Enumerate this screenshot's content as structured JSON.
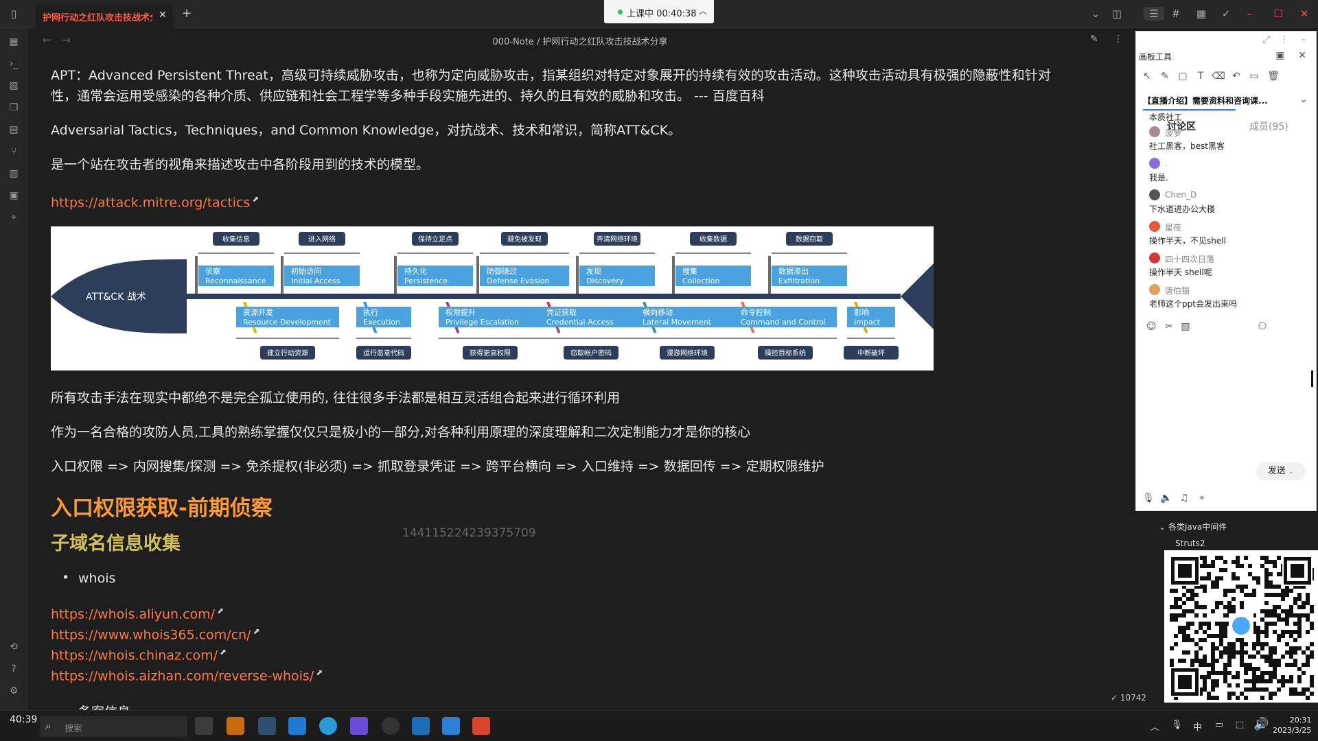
{
  "tab": {
    "title": "护网行动之红队攻击技战术分享",
    "close": "✕",
    "add": "+"
  },
  "live": {
    "status": "上课中 00:40:38"
  },
  "breadcrumb": "000-Note / 护网行动之红队攻击技战术分享",
  "doc": {
    "apt_line1": "APT：Advanced Persistent Threat，高级可持续威胁攻击，也称为定向威胁攻击，指某组织对特定对象展开的持续有效的攻击活动。这种攻击活动具有极强的隐蔽性和针对",
    "apt_line2": "性，通常会运用受感染的各种介质、供应链和社会工程学等多种手段实施先进的、持久的且有效的威胁和攻击。  --- 百度百科",
    "attck_def": "Adversarial Tactics，Techniques，and Common Knowledge，对抗战术、技术和常识，简称ATT&CK。",
    "model_desc": "是一个站在攻击者的视角来描述攻击中各阶段用到的技术的模型。",
    "mitre_link": "https://attack.mitre.org/tactics",
    "para1": "所有攻击手法在现实中都绝不是完全孤立使用的, 往往很多手法都是相互灵活组合起来进行循环利用",
    "para2": "作为一名合格的攻防人员,工具的熟练掌握仅仅只是极小的一部分,对各种利用原理的深度理解和二次定制能力才是你的核心",
    "chain": "入口权限 => 内网搜集/探测 => 免杀提权(非必须) => 抓取登录凭证 => 跨平台横向 => 入口维持 => 数据回传 => 定期权限维护",
    "h1": "入口权限获取-前期侦察",
    "h2": "子域名信息收集",
    "bullet_whois": "whois",
    "whois_links": [
      "https://whois.aliyun.com/",
      "https://www.whois365.com/cn/",
      "https://whois.chinaz.com/",
      "https://whois.aizhan.com/reverse-whois/"
    ],
    "bullet_partial": "备案信息",
    "watermark": "144115224239375709"
  },
  "diagram": {
    "head_label": "ATT&CK 战术",
    "top_phases": [
      "收集信息",
      "进入网络",
      "保持立足点",
      "避免被发现",
      "弄清网络环境",
      "收集数据",
      "数据窃取"
    ],
    "top_tactics": [
      {
        "cn": "侦察",
        "en": "Reconnaissance"
      },
      {
        "cn": "初始访问",
        "en": "Initial Access"
      },
      {
        "cn": "持久化",
        "en": "Persistence"
      },
      {
        "cn": "防御绕过",
        "en": "Defense Evasion"
      },
      {
        "cn": "发现",
        "en": "Discovery"
      },
      {
        "cn": "搜集",
        "en": "Collection"
      },
      {
        "cn": "数据渗出",
        "en": "Exfiltration"
      }
    ],
    "bottom_tactics": [
      {
        "cn": "资源开发",
        "en": "Resource Development"
      },
      {
        "cn": "执行",
        "en": "Execution"
      },
      {
        "cn": "权限提升",
        "en": "Privilege Escalation"
      },
      {
        "cn": "凭证获取",
        "en": "Credential Access"
      },
      {
        "cn": "横向移动",
        "en": "Lateral Movement"
      },
      {
        "cn": "命令控制",
        "en": "Command and Control"
      },
      {
        "cn": "影响",
        "en": "Impact"
      }
    ],
    "bottom_phases": [
      "建立行动资源",
      "运行恶意代码",
      "获得更高权限",
      "窃取帐户密码",
      "漫游网络环境",
      "操控目标系统",
      "中断破坏"
    ]
  },
  "panel": {
    "title": "画板工具",
    "course": "【直播介绍】需要资料和咨询课...",
    "tab_discuss": "讨论区",
    "tab_members": "成员(95)",
    "chat": [
      {
        "user": "",
        "msg": "本质社工"
      },
      {
        "user": "菠萝",
        "msg": "社工黑客，best黑客"
      },
      {
        "user": ".",
        "msg": "我是."
      },
      {
        "user": "Chen_D",
        "msg": "下水道进办公大楼"
      },
      {
        "user": "星夜",
        "msg": "操作半天，不见shell"
      },
      {
        "user": "四十四次日落",
        "msg": "操作半天 shell呢"
      },
      {
        "user": "唐伯猫",
        "msg": "老师这个ppt会发出来吗"
      }
    ],
    "send": "发送"
  },
  "tree": {
    "group": "各类Java中间件",
    "item": "Struts2"
  },
  "status_chip": "✓ 10742",
  "taskbar": {
    "clock_left": "40:39",
    "search_placeholder": "搜索",
    "time": "20:31",
    "date": "2023/3/25",
    "ime": "中"
  },
  "colors": {
    "link": "#ff7a45",
    "h1": "#ff9a30",
    "h2": "#d2c05a",
    "navy": "#2c3e5a",
    "tactic_blue": "#4aa3df"
  }
}
